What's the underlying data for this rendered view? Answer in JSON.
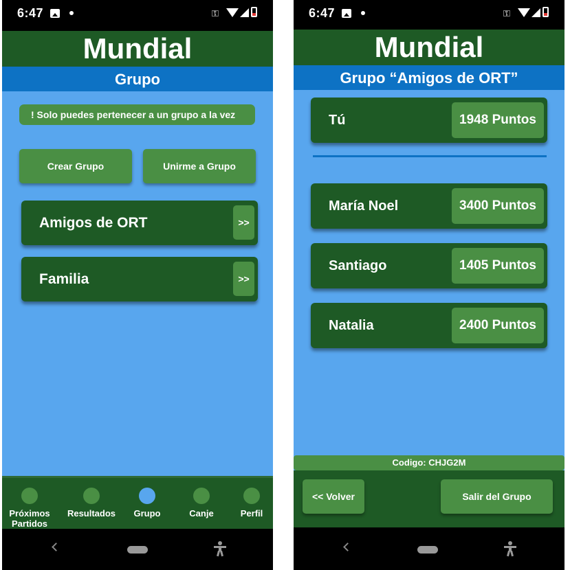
{
  "status_bar": {
    "time": "6:47"
  },
  "app": {
    "title": "Mundial"
  },
  "left_screen": {
    "subtitle": "Grupo",
    "notice": "! Solo puedes pertenecer a un grupo a la vez",
    "create_group_label": "Crear Grupo",
    "join_group_label": "Unirme a Grupo",
    "groups": [
      {
        "name": "Amigos de ORT",
        "action": ">>"
      },
      {
        "name": "Familia",
        "action": ">>"
      }
    ],
    "bottom_nav": [
      {
        "label": "Próximos Partidos",
        "active": false
      },
      {
        "label": "Resultados",
        "active": false
      },
      {
        "label": "Grupo",
        "active": true
      },
      {
        "label": "Canje",
        "active": false
      },
      {
        "label": "Perfil",
        "active": false
      }
    ]
  },
  "right_screen": {
    "subtitle": "Grupo “Amigos de ORT”",
    "self": {
      "name": "Tú",
      "points": "1948 Puntos"
    },
    "members": [
      {
        "name": "María Noel",
        "points": "3400 Puntos"
      },
      {
        "name": "Santiago",
        "points": "1405 Puntos"
      },
      {
        "name": "Natalia",
        "points": "2400 Puntos"
      }
    ],
    "code": "Codigo: CHJG2M",
    "back_label": "<< Volver",
    "leave_label": "Salir del Grupo"
  },
  "colors": {
    "dark_green": "#1e5a25",
    "medium_green": "#4a8f44",
    "blue_header": "#0d72c4",
    "light_blue_bg": "#58a6ee"
  }
}
